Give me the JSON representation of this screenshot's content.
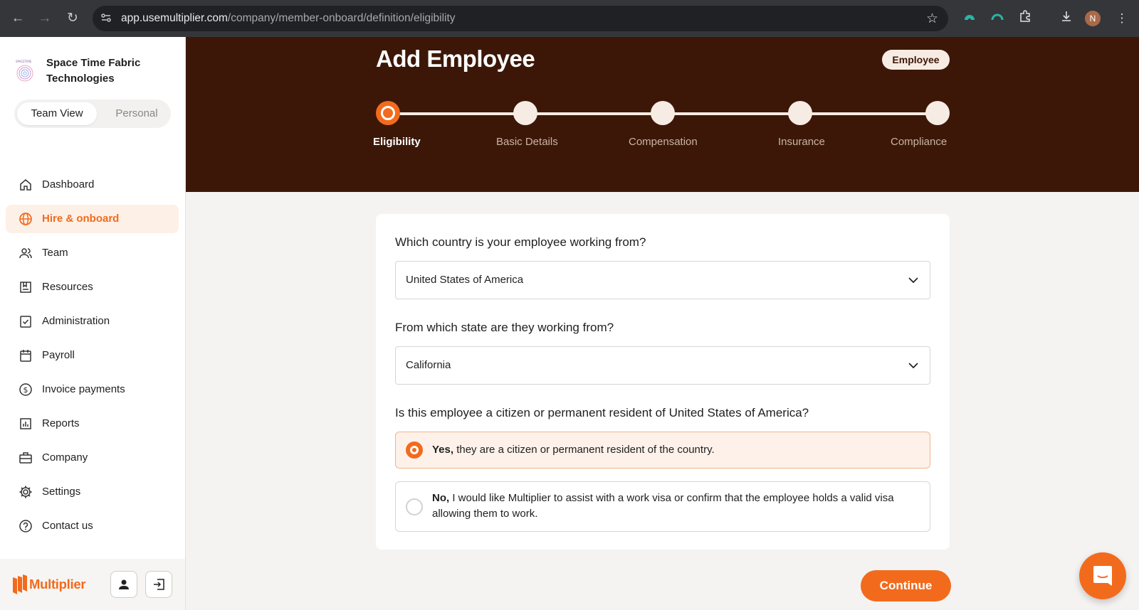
{
  "browser": {
    "url_host": "app.usemultiplier.com",
    "url_path": "/company/member-onboard/definition/eligibility",
    "profile_initial": "N"
  },
  "sidebar": {
    "company_name": "Space Time Fabric Technologies",
    "views": [
      "Team View",
      "Personal"
    ],
    "items": [
      {
        "label": "Dashboard",
        "icon": "home-icon"
      },
      {
        "label": "Hire & onboard",
        "icon": "globe-icon",
        "active": true
      },
      {
        "label": "Team",
        "icon": "team-icon"
      },
      {
        "label": "Resources",
        "icon": "resources-icon"
      },
      {
        "label": "Administration",
        "icon": "checklist-icon"
      },
      {
        "label": "Payroll",
        "icon": "calendar-icon"
      },
      {
        "label": "Invoice payments",
        "icon": "dollar-icon"
      },
      {
        "label": "Reports",
        "icon": "chart-icon"
      },
      {
        "label": "Company",
        "icon": "briefcase-icon"
      },
      {
        "label": "Settings",
        "icon": "gear-icon"
      },
      {
        "label": "Contact us",
        "icon": "help-icon"
      }
    ],
    "brand": "Multiplier"
  },
  "header": {
    "title": "Add Employee",
    "badge": "Employee",
    "steps": [
      "Eligibility",
      "Basic Details",
      "Compensation",
      "Insurance",
      "Compliance"
    ],
    "current_step": 0
  },
  "form": {
    "country_question": "Which country is your employee working from?",
    "country_value": "United States of America",
    "state_question": "From which state are they working from?",
    "state_value": "California",
    "citizen_question": "Is this employee a citizen or permanent resident of United States of America?",
    "option_yes_bold": "Yes,",
    "option_yes_text": "they are a citizen or permanent resident of the country.",
    "option_no_bold": "No,",
    "option_no_text": "I would like Multiplier to assist with a work visa or confirm that the employee holds a valid visa allowing them to work.",
    "selected_option": "yes"
  },
  "actions": {
    "continue_label": "Continue"
  },
  "colors": {
    "accent": "#f26b1d",
    "hero_bg": "#3c1708"
  }
}
